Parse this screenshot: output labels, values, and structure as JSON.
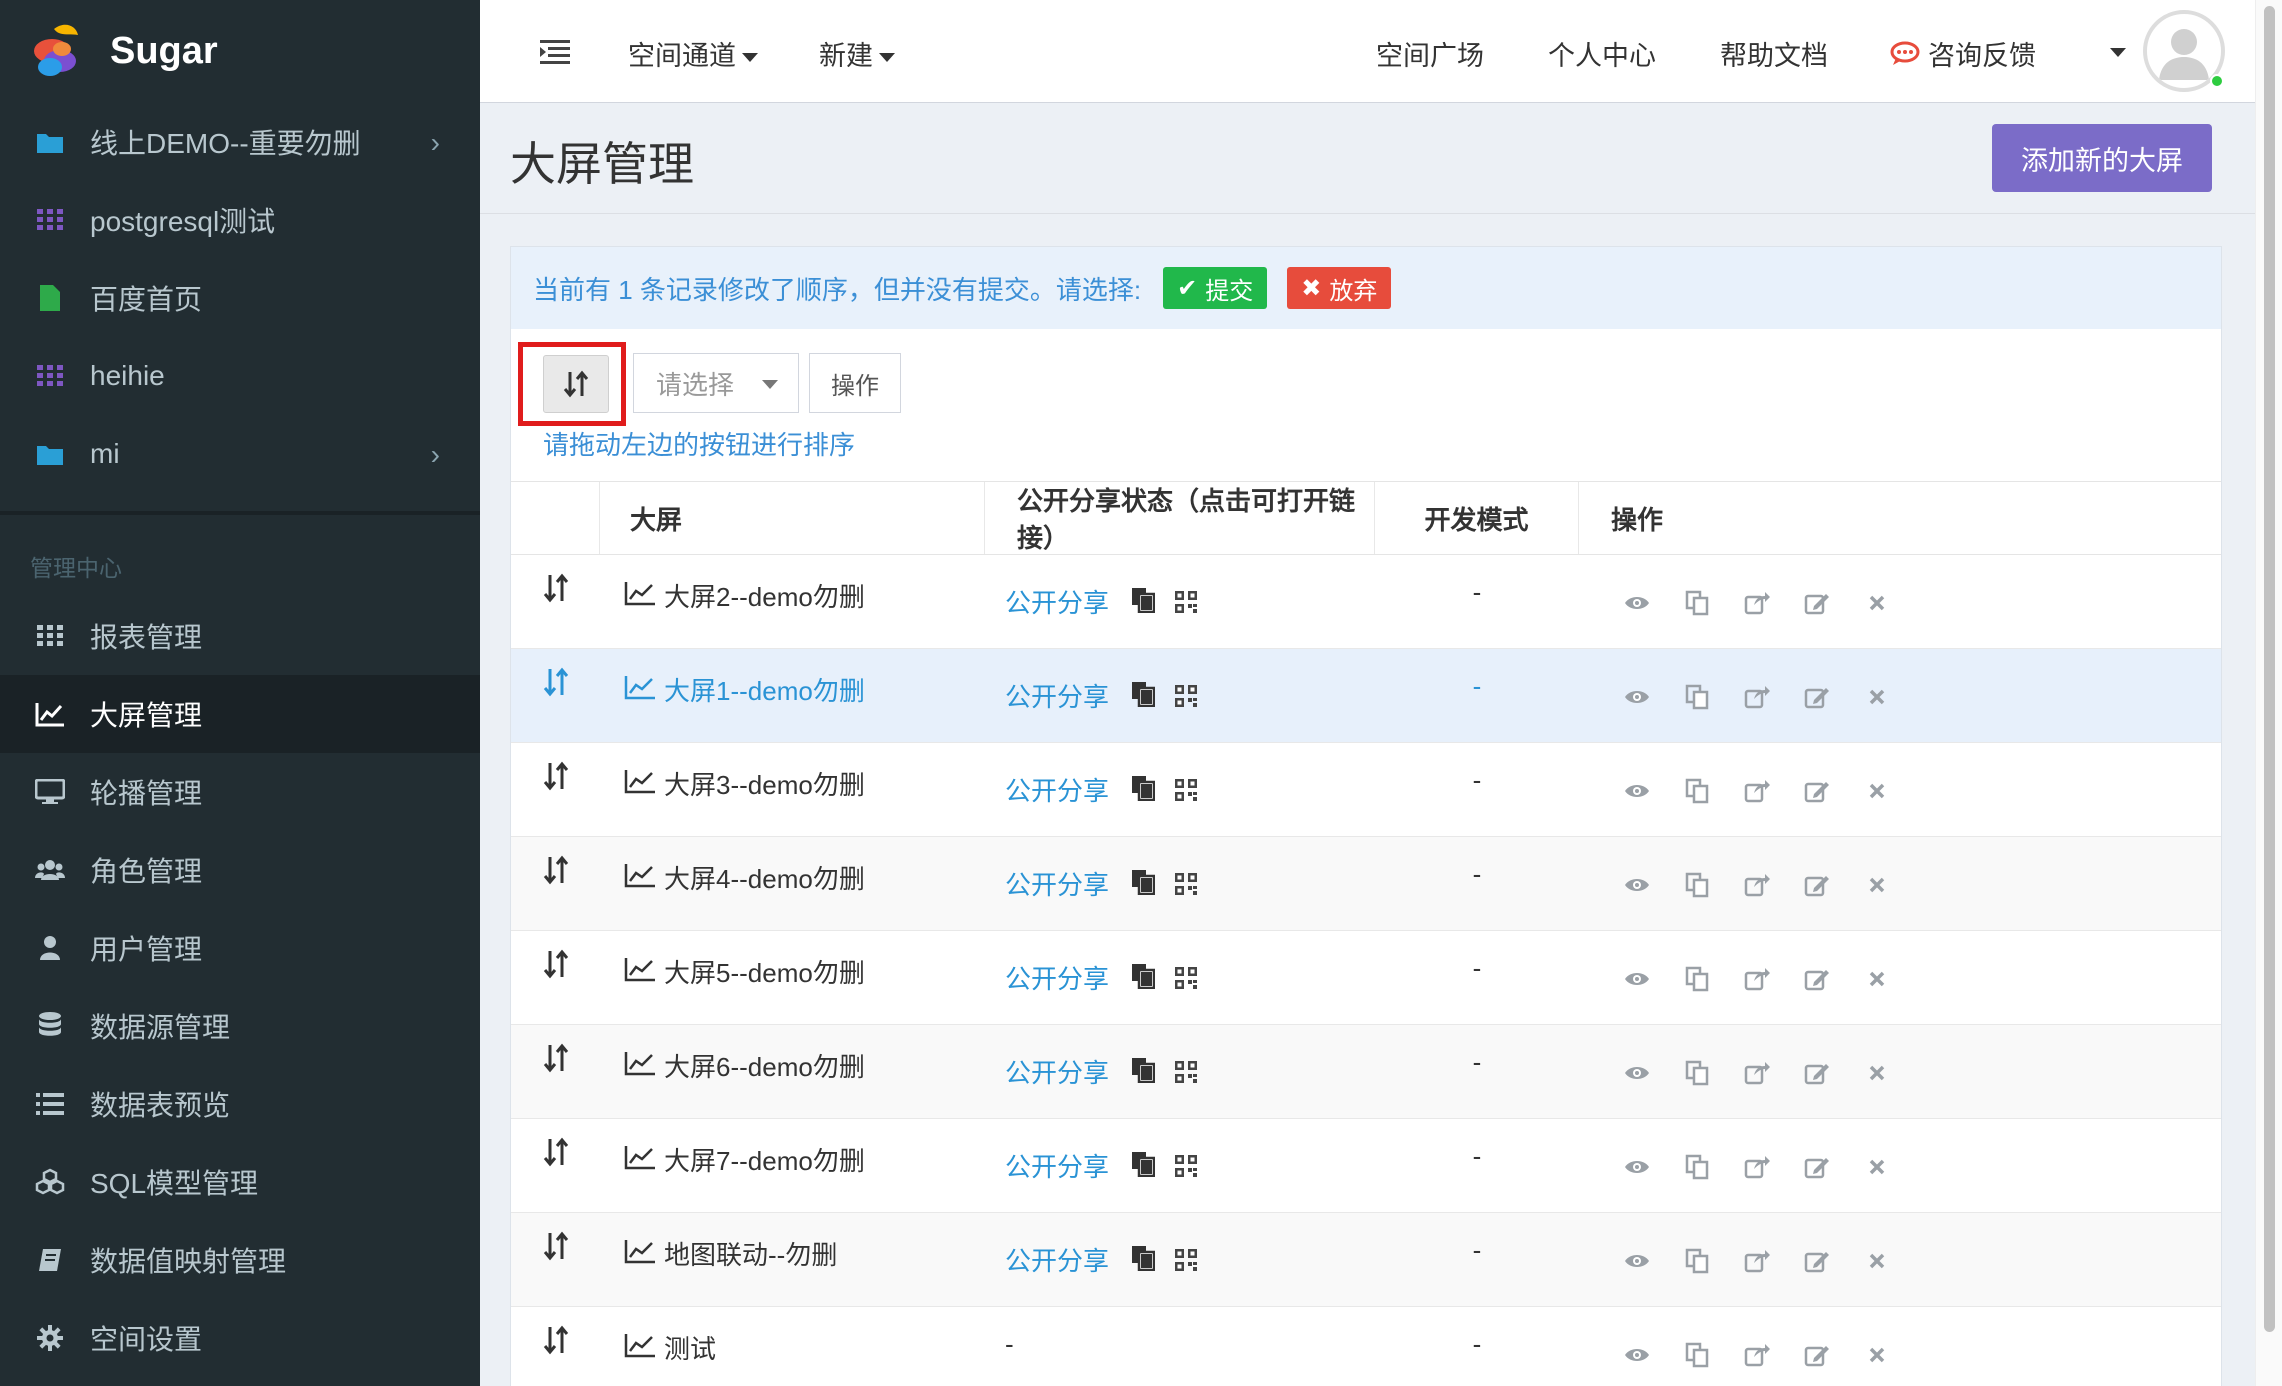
{
  "brand": {
    "title": "Sugar"
  },
  "sidebar": {
    "spaces": [
      {
        "label": "线上DEMO--重要勿删",
        "icon": "folder-icon",
        "has_children": true
      },
      {
        "label": "postgresql测试",
        "icon": "grid-icon",
        "has_children": false
      },
      {
        "label": "百度首页",
        "icon": "file-icon",
        "has_children": false
      },
      {
        "label": "heihie",
        "icon": "grid-icon",
        "has_children": false
      },
      {
        "label": "mi",
        "icon": "folder-icon",
        "has_children": true
      }
    ],
    "section_header": "管理中心",
    "items": [
      {
        "label": "报表管理",
        "icon": "th-icon"
      },
      {
        "label": "大屏管理",
        "icon": "line-chart-icon",
        "active": true
      },
      {
        "label": "轮播管理",
        "icon": "desktop-icon"
      },
      {
        "label": "角色管理",
        "icon": "users-icon"
      },
      {
        "label": "用户管理",
        "icon": "user-icon"
      },
      {
        "label": "数据源管理",
        "icon": "database-icon"
      },
      {
        "label": "数据表预览",
        "icon": "list-icon"
      },
      {
        "label": "SQL模型管理",
        "icon": "cubes-icon"
      },
      {
        "label": "数据值映射管理",
        "icon": "book-icon"
      },
      {
        "label": "空间设置",
        "icon": "gear-icon"
      }
    ]
  },
  "topbar": {
    "space_channel": "空间通道",
    "new": "新建",
    "plaza": "空间广场",
    "personal": "个人中心",
    "help": "帮助文档",
    "feedback": "咨询反馈"
  },
  "page": {
    "title": "大屏管理",
    "add_button": "添加新的大屏"
  },
  "alert": {
    "text": "当前有 1 条记录修改了顺序，但并没有提交。请选择:",
    "submit": "提交",
    "discard": "放弃"
  },
  "toolbar": {
    "select_placeholder": "请选择",
    "operate": "操作",
    "drag_hint": "请拖动左边的按钮进行排序"
  },
  "table": {
    "headers": [
      "大屏",
      "公开分享状态（点击可打开链接）",
      "开发模式",
      "操作"
    ],
    "rows": [
      {
        "name": "大屏2--demo勿删",
        "share": "公开分享",
        "dev": "-"
      },
      {
        "name": "大屏1--demo勿删",
        "share": "公开分享",
        "dev": "-",
        "selected": true
      },
      {
        "name": "大屏3--demo勿删",
        "share": "公开分享",
        "dev": "-"
      },
      {
        "name": "大屏4--demo勿删",
        "share": "公开分享",
        "dev": "-"
      },
      {
        "name": "大屏5--demo勿删",
        "share": "公开分享",
        "dev": "-"
      },
      {
        "name": "大屏6--demo勿删",
        "share": "公开分享",
        "dev": "-"
      },
      {
        "name": "大屏7--demo勿删",
        "share": "公开分享",
        "dev": "-"
      },
      {
        "name": "地图联动--勿删",
        "share": "公开分享",
        "dev": "-"
      },
      {
        "name": "测试",
        "share": "-",
        "dev": "-"
      }
    ]
  },
  "colors": {
    "sidebar": "#222d32",
    "accent": "#7b6cc8",
    "link": "#2a93d5",
    "success": "#21b84b",
    "danger": "#e74c3c"
  }
}
